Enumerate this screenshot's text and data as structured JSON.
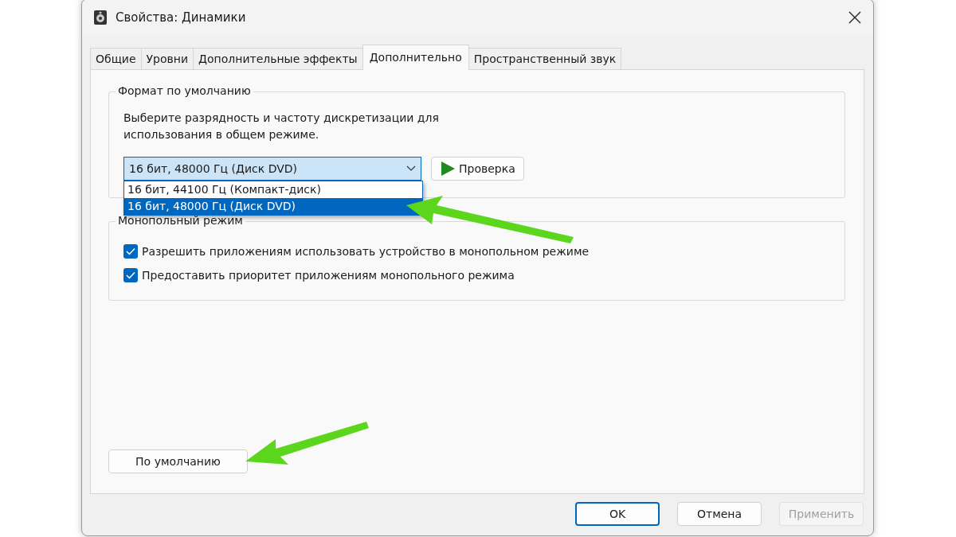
{
  "window": {
    "title": "Свойства: Динамики"
  },
  "tabs": [
    {
      "label": "Общие",
      "selected": false
    },
    {
      "label": "Уровни",
      "selected": false
    },
    {
      "label": "Дополнительные эффекты",
      "selected": false
    },
    {
      "label": "Дополнительно",
      "selected": true
    },
    {
      "label": "Пространственный звук",
      "selected": false
    }
  ],
  "default_format": {
    "title": "Формат по умолчанию",
    "description": "Выберите разрядность и частоту дискретизации для использования в общем режиме.",
    "format_select": {
      "value": "16 бит, 48000 Гц (Диск DVD)",
      "expanded": true,
      "options": [
        {
          "label": "16 бит, 44100 Гц (Компакт-диск)",
          "selected": false
        },
        {
          "label": "16 бит, 48000 Гц (Диск DVD)",
          "selected": true
        }
      ]
    },
    "test_button": "Проверка"
  },
  "exclusive_mode": {
    "title": "Монопольный режим",
    "options": [
      {
        "label": "Разрешить приложениям использовать устройство в монопольном режиме",
        "checked": true
      },
      {
        "label": "Предоставить приоритет приложениям монопольного режима",
        "checked": true
      }
    ]
  },
  "restore_defaults_button": "По умолчанию",
  "buttons": [
    {
      "label": "OK",
      "default": true,
      "disabled": false
    },
    {
      "label": "Отмена",
      "default": false,
      "disabled": false
    },
    {
      "label": "Применить",
      "default": false,
      "disabled": true
    }
  ]
}
